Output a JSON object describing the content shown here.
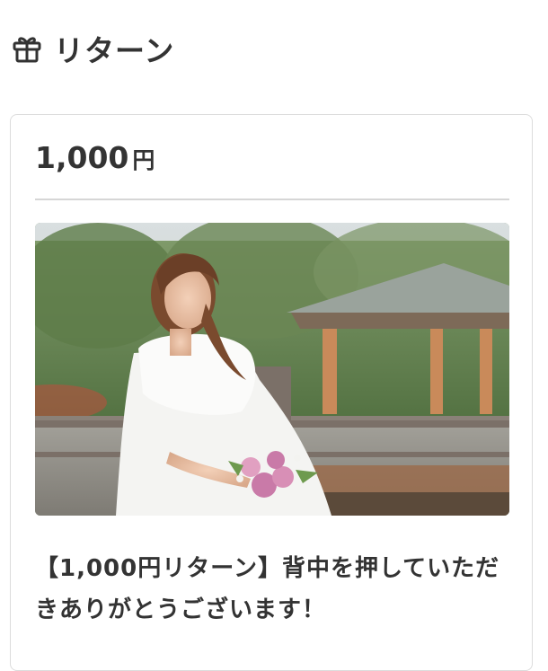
{
  "header": {
    "icon": "gift-icon",
    "title": "リターン"
  },
  "return_item": {
    "price_amount": "1,000",
    "price_unit": "円",
    "image": "wedding-dress-photo",
    "description": "【1,000円リターン】背中を押していただきありがとうございます！"
  }
}
